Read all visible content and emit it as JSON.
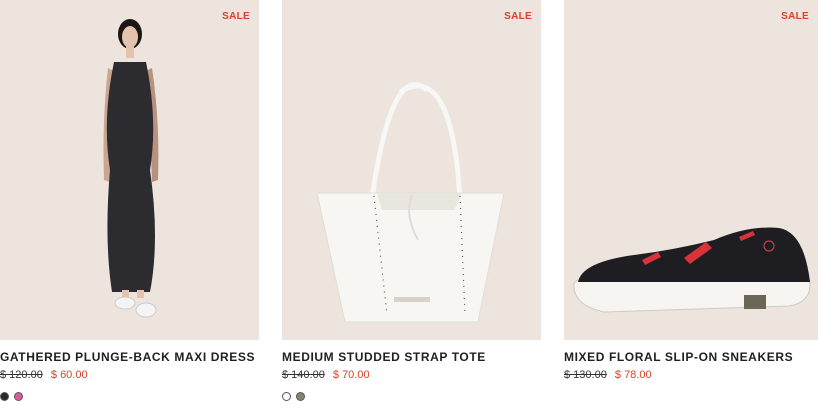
{
  "products": [
    {
      "badge": "SALE",
      "name": "GATHERED PLUNGE-BACK MAXI DRESS",
      "price_old": "$ 120.00",
      "price_new": "$ 60.00",
      "swatches": [
        "#2b2b2b",
        "#e05a9a"
      ],
      "image_icon": "dress-image"
    },
    {
      "badge": "SALE",
      "name": "MEDIUM STUDDED STRAP TOTE",
      "price_old": "$ 140.00",
      "price_new": "$ 70.00",
      "swatches": [
        "#ffffff",
        "#8a8270"
      ],
      "image_icon": "tote-bag-image"
    },
    {
      "badge": "SALE",
      "name": "MIXED FLORAL SLIP-ON SNEAKERS",
      "price_old": "$ 130.00",
      "price_new": "$ 78.00",
      "swatches": [],
      "image_icon": "sneaker-image"
    }
  ],
  "colors": {
    "sale_red": "#d9412b",
    "image_bg": "#ece4dd",
    "title": "#1f1f1f"
  }
}
